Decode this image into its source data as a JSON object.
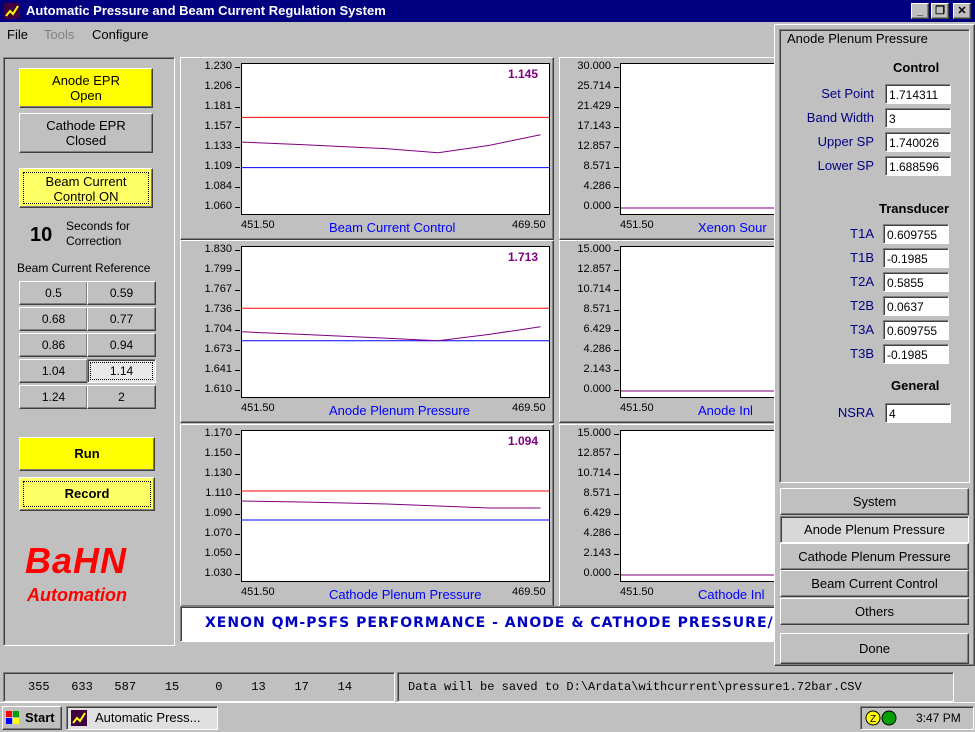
{
  "window": {
    "title": "Automatic Pressure and Beam Current Regulation System",
    "minimize": "_",
    "restore": "❐",
    "close": "✕"
  },
  "menu": [
    "File",
    "Tools",
    "Configure"
  ],
  "left": {
    "anode_epr": "Anode EPR\nOpen",
    "cathode_epr": "Cathode EPR\nClosed",
    "beam_control": "Beam Current\nControl ON",
    "seconds_value": "10",
    "seconds_label": "Seconds for\nCorrection",
    "reference_label": "Beam Current Reference",
    "reference_values": [
      "0.5",
      "0.59",
      "0.68",
      "0.77",
      "0.86",
      "0.94",
      "1.04",
      "1.14",
      "1.24",
      "2"
    ],
    "run": "Run",
    "record": "Record",
    "logo_top": "BaHN",
    "logo_bottom": "Automation"
  },
  "charts": [
    {
      "title": "Beam Current Control",
      "value": "1.145",
      "x_min": "451.50",
      "x_max": "469.50",
      "yticks": [
        "1.230",
        "1.206",
        "1.181",
        "1.157",
        "1.133",
        "1.109",
        "1.084",
        "1.060"
      ]
    },
    {
      "title": "Xenon Sour",
      "value": "",
      "x_min": "451.50",
      "x_max": "",
      "yticks": [
        "30.000",
        "25.714",
        "21.429",
        "17.143",
        "12.857",
        "8.571",
        "4.286",
        "0.000"
      ]
    },
    {
      "title": "Anode Plenum Pressure",
      "value": "1.713",
      "x_min": "451.50",
      "x_max": "469.50",
      "yticks": [
        "1.830",
        "1.799",
        "1.767",
        "1.736",
        "1.704",
        "1.673",
        "1.641",
        "1.610"
      ]
    },
    {
      "title": "Anode Inl",
      "value": "",
      "x_min": "451.50",
      "x_max": "",
      "yticks": [
        "15.000",
        "12.857",
        "10.714",
        "8.571",
        "6.429",
        "4.286",
        "2.143",
        "0.000"
      ]
    },
    {
      "title": "Cathode Plenum Pressure",
      "value": "1.094",
      "x_min": "451.50",
      "x_max": "469.50",
      "yticks": [
        "1.170",
        "1.150",
        "1.130",
        "1.110",
        "1.090",
        "1.070",
        "1.050",
        "1.030"
      ]
    },
    {
      "title": "Cathode Inl",
      "value": "",
      "x_min": "451.50",
      "x_max": "",
      "yticks": [
        "15.000",
        "12.857",
        "10.714",
        "8.571",
        "6.429",
        "4.286",
        "2.143",
        "0.000"
      ]
    }
  ],
  "chart_data": [
    {
      "type": "line",
      "title": "Beam Current Control",
      "ylim": [
        1.06,
        1.23
      ],
      "xlim": [
        451.5,
        469.5
      ],
      "setpoint_upper": 1.17,
      "setpoint_lower": 1.109,
      "series": [
        {
          "x": [
            451.5,
            455,
            460,
            463,
            466,
            469
          ],
          "values": [
            1.14,
            1.137,
            1.132,
            1.127,
            1.136,
            1.149
          ]
        }
      ]
    },
    {
      "type": "line",
      "title": "Xenon Sour",
      "ylim": [
        0,
        30
      ],
      "series": [
        {
          "values": [
            0,
            0
          ]
        }
      ]
    },
    {
      "type": "line",
      "title": "Anode Plenum Pressure",
      "ylim": [
        1.61,
        1.83
      ],
      "xlim": [
        451.5,
        469.5
      ],
      "setpoint_upper": 1.74,
      "setpoint_lower": 1.689,
      "series": [
        {
          "x": [
            451.5,
            455,
            460,
            463,
            466,
            469
          ],
          "values": [
            1.703,
            1.699,
            1.693,
            1.689,
            1.699,
            1.711
          ]
        }
      ]
    },
    {
      "type": "line",
      "title": "Anode Inl",
      "ylim": [
        0,
        15
      ],
      "series": [
        {
          "values": [
            0,
            0
          ]
        }
      ]
    },
    {
      "type": "line",
      "title": "Cathode Plenum Pressure",
      "ylim": [
        1.03,
        1.17
      ],
      "xlim": [
        451.5,
        469.5
      ],
      "setpoint_upper": 1.114,
      "setpoint_lower": 1.085,
      "series": [
        {
          "x": [
            451.5,
            455,
            460,
            463,
            466,
            469
          ],
          "values": [
            1.104,
            1.103,
            1.101,
            1.099,
            1.097,
            1.097
          ]
        }
      ]
    },
    {
      "type": "line",
      "title": "Cathode Inl",
      "ylim": [
        0,
        15
      ],
      "series": [
        {
          "values": [
            0,
            0
          ]
        }
      ]
    }
  ],
  "banner": "XENON QM-PSFS PERFORMANCE -  ANODE & CATHODE PRESSURE/",
  "right": {
    "title": "Anode Plenum Pressure",
    "control_head": "Control",
    "control": [
      {
        "label": "Set Point",
        "value": "1.714311"
      },
      {
        "label": "Band Width",
        "value": "3"
      },
      {
        "label": "Upper SP",
        "value": "1.740026"
      },
      {
        "label": "Lower SP",
        "value": "1.688596"
      }
    ],
    "transducer_head": "Transducer",
    "transducer": [
      {
        "label": "T1A",
        "value": "0.609755"
      },
      {
        "label": "T1B",
        "value": "-0.1985"
      },
      {
        "label": "T2A",
        "value": "0.5855"
      },
      {
        "label": "T2B",
        "value": "0.0637"
      },
      {
        "label": "T3A",
        "value": "0.609755"
      },
      {
        "label": "T3B",
        "value": "-0.1985"
      }
    ],
    "general_head": "General",
    "nsra_label": "NSRA",
    "nsra_value": "4",
    "nav": [
      "System",
      "Anode Plenum Pressure",
      "Cathode Plenum Pressure",
      "Beam Current Control",
      "Others"
    ],
    "done": "Done"
  },
  "status": {
    "numbers": "355   633   587    15     0    13    17    14",
    "message": "Data will be saved to D:\\Ardata\\withcurrent\\pressure1.72bar.CSV"
  },
  "taskbar": {
    "start": "Start",
    "task": "Automatic Press...",
    "clock": "3:47 PM"
  },
  "colors": {
    "title_bar": "#000080",
    "upper_sp_line": "#ff0000",
    "lower_sp_line": "#0000ff",
    "data_line": "#800080",
    "value_text": "#800080",
    "chart_title": "#0000ff"
  }
}
